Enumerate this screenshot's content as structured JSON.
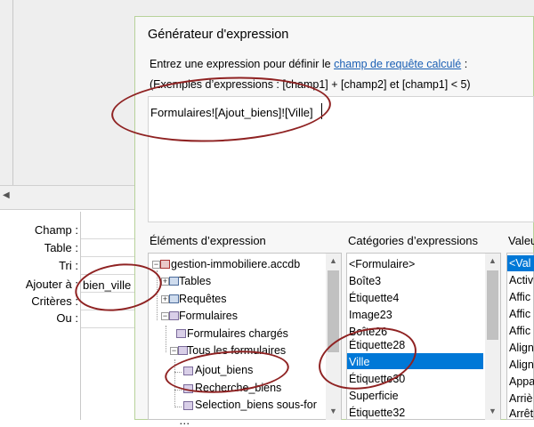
{
  "query_grid": {
    "row_labels": [
      "Champ :",
      "Table :",
      "Tri :",
      "Ajouter à :",
      "Critères :",
      "Ou :"
    ],
    "append_to_value": "bien_ville"
  },
  "dialog": {
    "title": "Générateur d'expression",
    "instruction_prefix": "Entrez une expression pour définir le ",
    "instruction_link": "champ de requête calculé",
    "instruction_suffix": " :",
    "examples": "(Exemples d’expressions : [champ1] + [champ2] et [champ1] < 5)",
    "expression": "Formulaires![Ajout_biens]![Ville]"
  },
  "sections": {
    "elements_title": "Éléments d’expression",
    "categories_title": "Catégories d’expressions",
    "values_title": "Valeurs d’expressions"
  },
  "elements_tree": [
    {
      "label": "gestion-immobiliere.accdb",
      "icon": "database-icon",
      "expander": "−"
    },
    {
      "label": "Tables",
      "icon": "table-icon",
      "expander": "+"
    },
    {
      "label": "Requêtes",
      "icon": "query-icon",
      "expander": "+"
    },
    {
      "label": "Formulaires",
      "icon": "form-icon",
      "expander": "−"
    },
    {
      "label": "Formulaires chargés",
      "icon": "form-icon",
      "expander": ""
    },
    {
      "label": "Tous les formulaires",
      "icon": "form-icon",
      "expander": "−"
    },
    {
      "label": "Ajout_biens",
      "icon": "form-icon",
      "expander": ""
    },
    {
      "label": "Recherche_biens",
      "icon": "form-icon",
      "expander": ""
    },
    {
      "label": "Selection_biens sous-for",
      "icon": "form-icon",
      "expander": ""
    }
  ],
  "categories": [
    "<Formulaire>",
    "Boîte3",
    "Étiquette4",
    "Image23",
    "Boîte26",
    "Étiquette28",
    "Ville",
    "Étiquette30",
    "Superficie",
    "Étiquette32"
  ],
  "categories_selected": "Ville",
  "values": [
    "<Val",
    "Activ",
    "Affic",
    "Affic",
    "Affic",
    "Align",
    "Align",
    "Appa",
    "Arriè",
    "Arrêt"
  ],
  "colors": {
    "selection": "#0078d7",
    "link": "#1a5fb4",
    "annotation_ring": "#8f2222",
    "dialog_border": "#b7d29a"
  }
}
